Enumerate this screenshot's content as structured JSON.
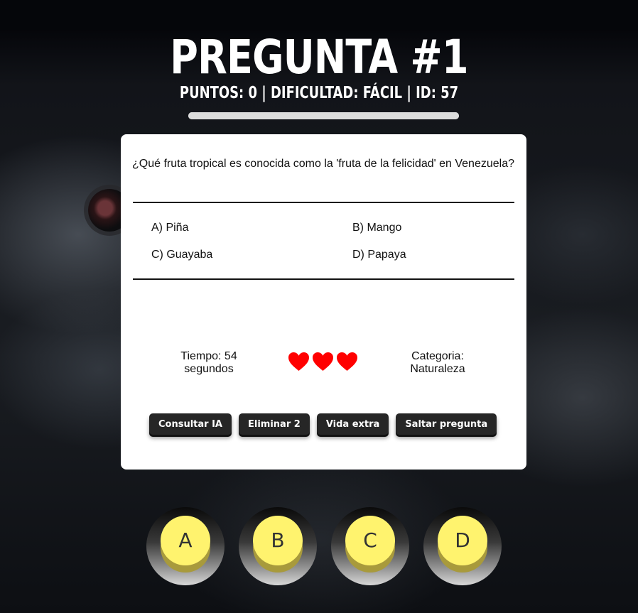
{
  "header": {
    "title": "PREGUNTA #1",
    "stats": "PUNTOS: 0 | DIFICULTAD: FÁCIL | ID: 57"
  },
  "question": {
    "text": "¿Qué fruta tropical es conocida como la 'fruta de la felicidad' en Venezuela?",
    "options": [
      "A) Piña",
      "B) Mango",
      "C) Guayaba",
      "D) Papaya"
    ]
  },
  "status": {
    "time_line1": "Tiempo: 54",
    "time_line2": "segundos",
    "lives": 3,
    "category_line1": "Categoria:",
    "category_line2": "Naturaleza"
  },
  "actions": {
    "consult_ai": "Consultar IA",
    "remove_two": "Eliminar 2",
    "extra_life": "Vida extra",
    "skip": "Saltar pregunta"
  },
  "answer_buttons": [
    "A",
    "B",
    "C",
    "D"
  ],
  "colors": {
    "heart": "#ff0000",
    "answer_button": "#fff36e",
    "action_button": "#262626"
  },
  "icons": {
    "life": "heart-icon"
  }
}
